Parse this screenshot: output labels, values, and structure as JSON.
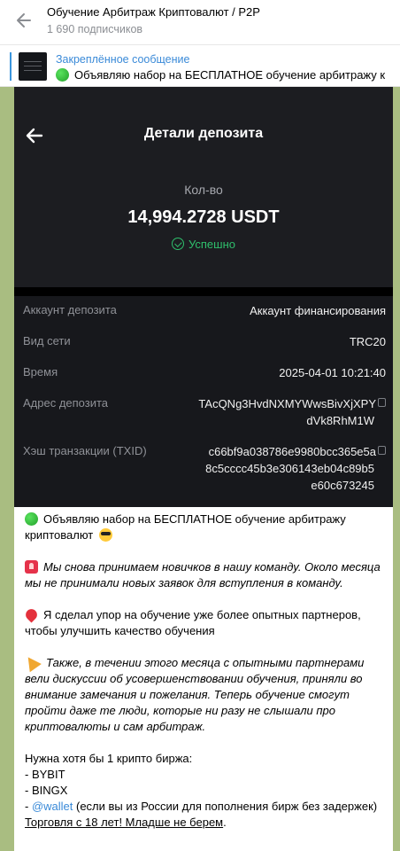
{
  "header": {
    "title": "Обучение Арбитраж Криптовалют / P2P",
    "subscribers": "1 690 подписчиков"
  },
  "pinned": {
    "label": "Закреплённое сообщение",
    "text": "Объявляю набор на БЕСПЛАТНОЕ обучение арбитражу к"
  },
  "screenshot": {
    "title": "Детали депозита",
    "amount_label": "Кол-во",
    "amount_value": "14,994.2728 USDT",
    "status": "Успешно",
    "rows": [
      {
        "key": "Аккаунт депозита",
        "value": "Аккаунт финансирования"
      },
      {
        "key": "Вид сети",
        "value": "TRC20"
      },
      {
        "key": "Время",
        "value": "2025-04-01 10:21:40"
      },
      {
        "key": "Адрес депозита",
        "value_lines": [
          "TAcQNg3HvdNXMYWwsBivXjXPY",
          "dVk8RhM1W"
        ]
      },
      {
        "key": "Хэш транзакции (TXID)",
        "value_lines": [
          "c66bf9a038786e9980bcc365e5a",
          "8c5cccc45b3e306143eb04c89b5",
          "e60c673245"
        ]
      }
    ]
  },
  "message": {
    "p1_line1": "Объявляю набор на БЕСПЛАТНОЕ обучение арбитражу",
    "p1_line2": "криптовалют",
    "p2": "Мы снова принимаем новичков в нашу команду. Около месяца мы не принимали новых заявок для вступления в команду.",
    "p3": "Я сделал упор на обучение уже более опытных партнеров, чтобы улучшить качество обучения",
    "p4": "Также, в течении этого месяца с опытными партнерами вели дискуссии об усовершенствовании обучения, приняли во внимание замечания и пожелания. Теперь обучение смогут пройти даже те люди, которые ни разу не слышали про криптовалюты и сам арбитраж.",
    "list_title": "Нужна хотя бы 1 крипто биржа:",
    "list_items": [
      "- BYBIT",
      "- BINGX"
    ],
    "wallet_prefix": "- ",
    "wallet_link": "@wallet",
    "wallet_suffix": " (если вы из России для пополнения бирж без задержек)",
    "age_note": "Торговля с 18 лет! Младше не берем",
    "age_note_tail": "."
  },
  "colors": {
    "accent": "#3a8ad8",
    "chat_bg": "#a9bd81",
    "success": "#2fbf6c"
  }
}
